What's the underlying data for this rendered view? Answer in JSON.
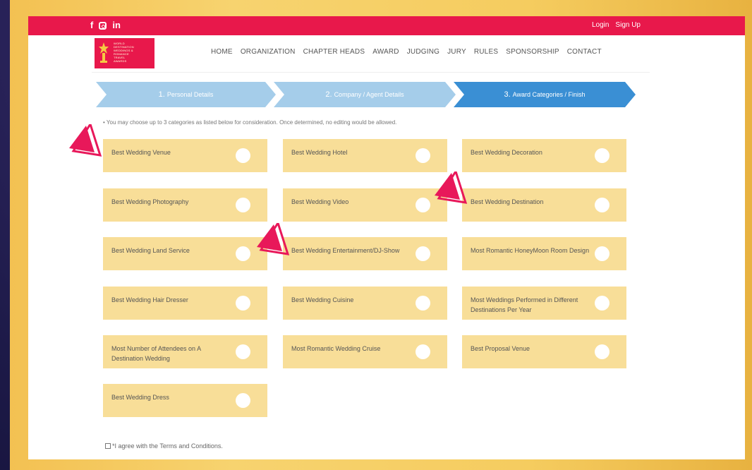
{
  "topbar": {
    "social": [
      "f",
      "in"
    ],
    "login": "Login",
    "signup": "Sign Up",
    "bg_color": "#e8184b"
  },
  "logo": {
    "text_lines": [
      "WORLD",
      "DESTINATION",
      "WEDDINGS &",
      "ROMANCE",
      "TRAVEL",
      "AWARDS"
    ]
  },
  "nav": [
    "HOME",
    "ORGANIZATION",
    "CHAPTER HEADS",
    "AWARD",
    "JUDGING",
    "JURY",
    "RULES",
    "SPONSORSHIP",
    "CONTACT"
  ],
  "steps": [
    {
      "num": "1.",
      "label": "Personal Details"
    },
    {
      "num": "2.",
      "label": "Company / Agent Details"
    },
    {
      "num": "3.",
      "label": "Award Categories / Finish"
    }
  ],
  "note": "You may choose up to 3 categories as listed below for consideration. Once determined, no editing would be allowed.",
  "categories": [
    "Best Wedding Venue",
    "Best Wedding Hotel",
    "Best Wedding Decoration",
    "Best Wedding Photography",
    "Best Wedding Video",
    "Best Wedding Destination",
    "Best Wedding Land Service",
    "Best Wedding Entertainment/DJ-Show",
    "Most Romantic HoneyMoon Room Design",
    "Best Wedding Hair Dresser",
    "Best Wedding Cuisine",
    "Most Weddings Performed in Different Destinations Per Year",
    "Most Number of Attendees on A Destination Wedding",
    "Most Romantic Wedding Cruise",
    "Best Proposal Venue",
    "Best Wedding Dress"
  ],
  "agree": "*I agree with the Terms and Conditions.",
  "colors": {
    "card": "#f8de98",
    "step_active": "#3a8fd4",
    "step_inactive": "#a5cdea",
    "accent": "#e8184b"
  }
}
